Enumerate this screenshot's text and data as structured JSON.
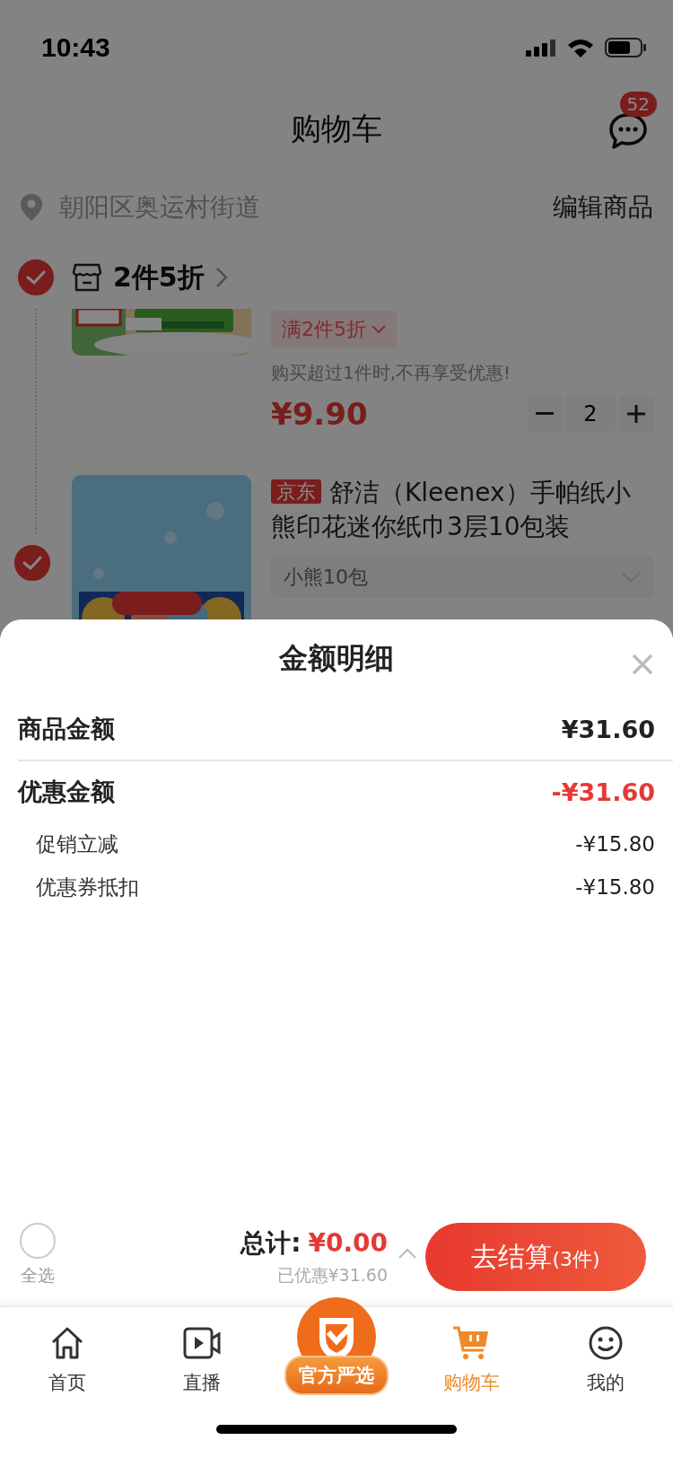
{
  "status_bar": {
    "time": "10:43"
  },
  "header": {
    "title": "购物车",
    "message_badge": "52"
  },
  "address": {
    "text": "朝阳区奥运村街道",
    "edit_label": "编辑商品"
  },
  "store_group": {
    "checked": true,
    "title": "2件5折"
  },
  "cart_items": [
    {
      "kind": "partial",
      "promo_tag": "满2件5折",
      "note": "购买超过1件时,不再享受优惠!",
      "price": "¥9.90",
      "quantity": "2"
    },
    {
      "kind": "full",
      "checked": true,
      "source_tag": "京东",
      "title": "舒洁（Kleenex）手帕纸小熊印花迷你纸巾3层10包装",
      "variant": "小熊10包"
    }
  ],
  "sheet": {
    "title": "金额明细",
    "rows": [
      {
        "kind": "main",
        "label": "商品金额",
        "value": "¥31.60",
        "negative": false
      },
      {
        "kind": "main",
        "label": "优惠金额",
        "value": "-¥31.60",
        "negative": true
      },
      {
        "kind": "sub",
        "label": "促销立减",
        "value": "-¥15.80",
        "negative": false
      },
      {
        "kind": "sub",
        "label": "优惠券抵扣",
        "value": "-¥15.80",
        "negative": false
      }
    ]
  },
  "checkout": {
    "select_all_label": "全选",
    "all_selected": false,
    "total_label": "总计:",
    "total_value": "¥0.00",
    "saved": "已优惠¥31.60",
    "button_label": "去结算",
    "button_count": "(3件)"
  },
  "tabs": [
    {
      "kind": "normal",
      "label": "首页",
      "selected": false
    },
    {
      "kind": "normal",
      "label": "直播",
      "selected": false
    },
    {
      "kind": "badge",
      "label": "官方严选",
      "selected": false
    },
    {
      "kind": "normal",
      "label": "购物车",
      "selected": true
    },
    {
      "kind": "normal",
      "label": "我的",
      "selected": false
    }
  ]
}
